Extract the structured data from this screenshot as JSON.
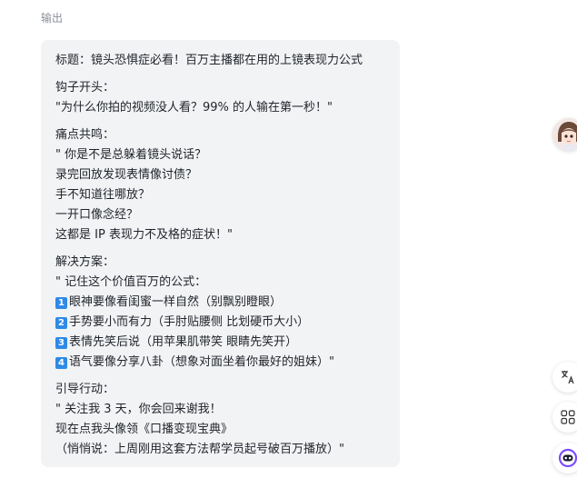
{
  "output_label": "输出",
  "content": {
    "title": "标题：镜头恐惧症必看！百万主播都在用的上镜表现力公式",
    "hook": {
      "heading": "钩子开头：",
      "lines": [
        "\"为什么你拍的视频没人看？99% 的人输在第一秒！\""
      ]
    },
    "pain": {
      "heading": "痛点共鸣：",
      "lines": [
        "\" 你是不是总躲着镜头说话？",
        "录完回放发现表情像讨债？",
        "手不知道往哪放？",
        "一开口像念经？",
        "这都是 IP 表现力不及格的症状！\""
      ]
    },
    "solution": {
      "heading": "解决方案：",
      "intro": "\" 记住这个价值百万的公式：",
      "items": [
        {
          "badge": "1",
          "text": "眼神要像看闺蜜一样自然（别飘别瞪眼）"
        },
        {
          "badge": "2",
          "text": "手势要小而有力（手肘贴腰侧 比划硬币大小）"
        },
        {
          "badge": "3",
          "text": "表情先笑后说（用苹果肌带笑 眼睛先笑开）"
        },
        {
          "badge": "4",
          "text": "语气要像分享八卦（想象对面坐着你最好的姐妹）\""
        }
      ]
    },
    "cta": {
      "heading": "引导行动：",
      "lines": [
        "\" 关注我 3 天，你会回来谢我！",
        "现在点我头像领《口播变现宝典》",
        "（悄悄说：上周刚用这套方法帮学员起号破百万播放）\""
      ]
    }
  },
  "colors": {
    "card_bg": "#f2f3f5",
    "text": "#1f2329",
    "label": "#8a8f99",
    "badge": "#2e8ae6",
    "assistant_accent": "#7b4dff"
  },
  "icons": {
    "avatar": "assistant-avatar-icon",
    "translate": "translate-icon",
    "apps": "apps-grid-icon",
    "assistant": "ai-assistant-icon"
  }
}
